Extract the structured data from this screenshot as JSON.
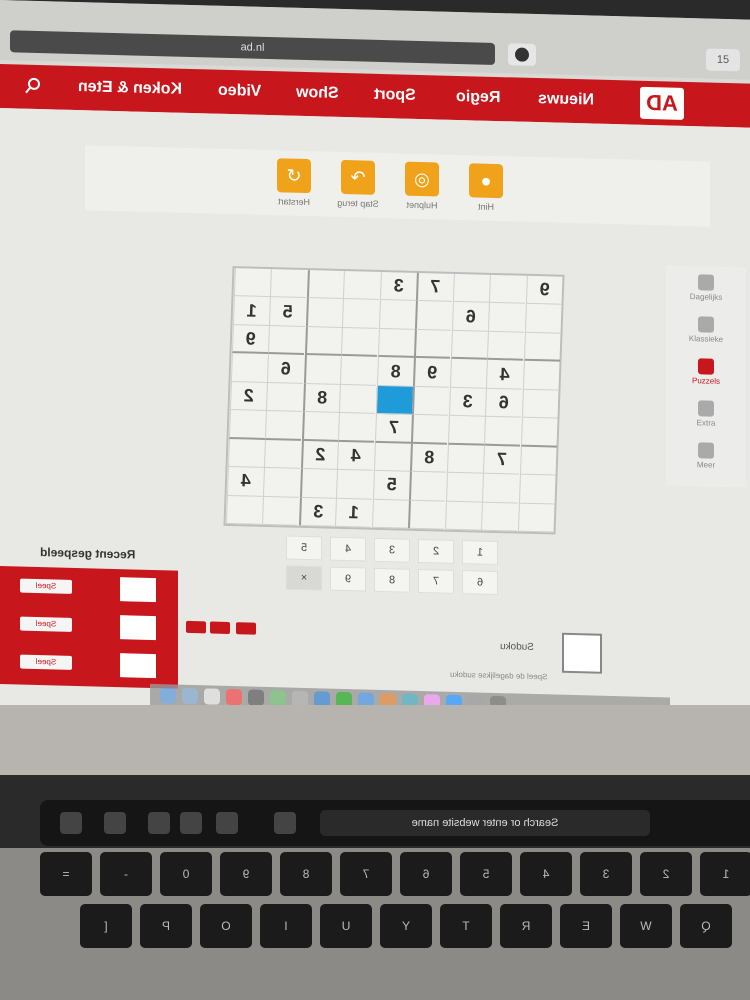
{
  "browser": {
    "url": "ad.nl",
    "tabs_label": "15"
  },
  "nav": {
    "logo": "AD",
    "items": [
      {
        "label": "Nieuws"
      },
      {
        "label": "Regio"
      },
      {
        "label": "Sport"
      },
      {
        "label": "Show"
      },
      {
        "label": "Video"
      },
      {
        "label": "Koken & Eten"
      }
    ]
  },
  "toolbar": {
    "tools": [
      {
        "label": "Hint",
        "icon": "lightbulb-icon"
      },
      {
        "label": "Hulpnet",
        "icon": "eye-off-icon"
      },
      {
        "label": "Stap terug",
        "icon": "undo-icon"
      },
      {
        "label": "Herstart",
        "icon": "restart-icon"
      }
    ]
  },
  "sudoku": {
    "rows": [
      [
        "",
        "",
        "",
        "",
        "3",
        "7",
        "",
        "",
        "9"
      ],
      [
        "1",
        "5",
        "",
        "",
        "",
        "",
        "6",
        "",
        ""
      ],
      [
        "9",
        "",
        "",
        "",
        "",
        "",
        "",
        "",
        ""
      ],
      [
        "",
        "6",
        "",
        "",
        "8",
        "9",
        "",
        "4",
        ""
      ],
      [
        "2",
        "",
        "8",
        "",
        "",
        "",
        "3",
        "6",
        ""
      ],
      [
        "",
        "",
        "",
        "",
        "7",
        "",
        "",
        "",
        ""
      ],
      [
        "",
        "",
        "2",
        "4",
        "",
        "8",
        "",
        "7",
        ""
      ],
      [
        "4",
        "",
        "",
        "",
        "5",
        "",
        "",
        "",
        ""
      ],
      [
        "",
        "",
        "3",
        "1",
        "",
        "",
        "",
        "",
        ""
      ]
    ],
    "selected": {
      "row": 4,
      "col": 4
    }
  },
  "numpad": {
    "row1": [
      "1",
      "2",
      "3",
      "4",
      "5"
    ],
    "row2": [
      "6",
      "7",
      "8",
      "9",
      "×"
    ]
  },
  "sidebar": {
    "items": [
      {
        "label": "Dagelijks",
        "icon": "calendar-icon"
      },
      {
        "label": "Klassieke",
        "icon": "grid-icon"
      },
      {
        "label": "Puzzels",
        "icon": "puzzle-icon"
      },
      {
        "label": "Extra",
        "icon": "star-icon"
      },
      {
        "label": "Meer",
        "icon": "more-icon"
      }
    ]
  },
  "recent": {
    "title": "Recent gespeeld",
    "items": [
      {
        "button": "Speel"
      },
      {
        "button": "Speel"
      },
      {
        "button": "Speel"
      }
    ]
  },
  "promo": {
    "title": "Sudoku",
    "subtitle": "Speel de dagelijkse sudoku"
  },
  "touchbar": {
    "search": "Search or enter website name"
  },
  "keyboard": {
    "row1": [
      "1",
      "2",
      "3",
      "4",
      "5",
      "6",
      "7",
      "8",
      "9",
      "0",
      "-",
      "="
    ],
    "row2": [
      "Q",
      "W",
      "E",
      "R",
      "T",
      "Y",
      "U",
      "I",
      "O",
      "P",
      "["
    ]
  }
}
